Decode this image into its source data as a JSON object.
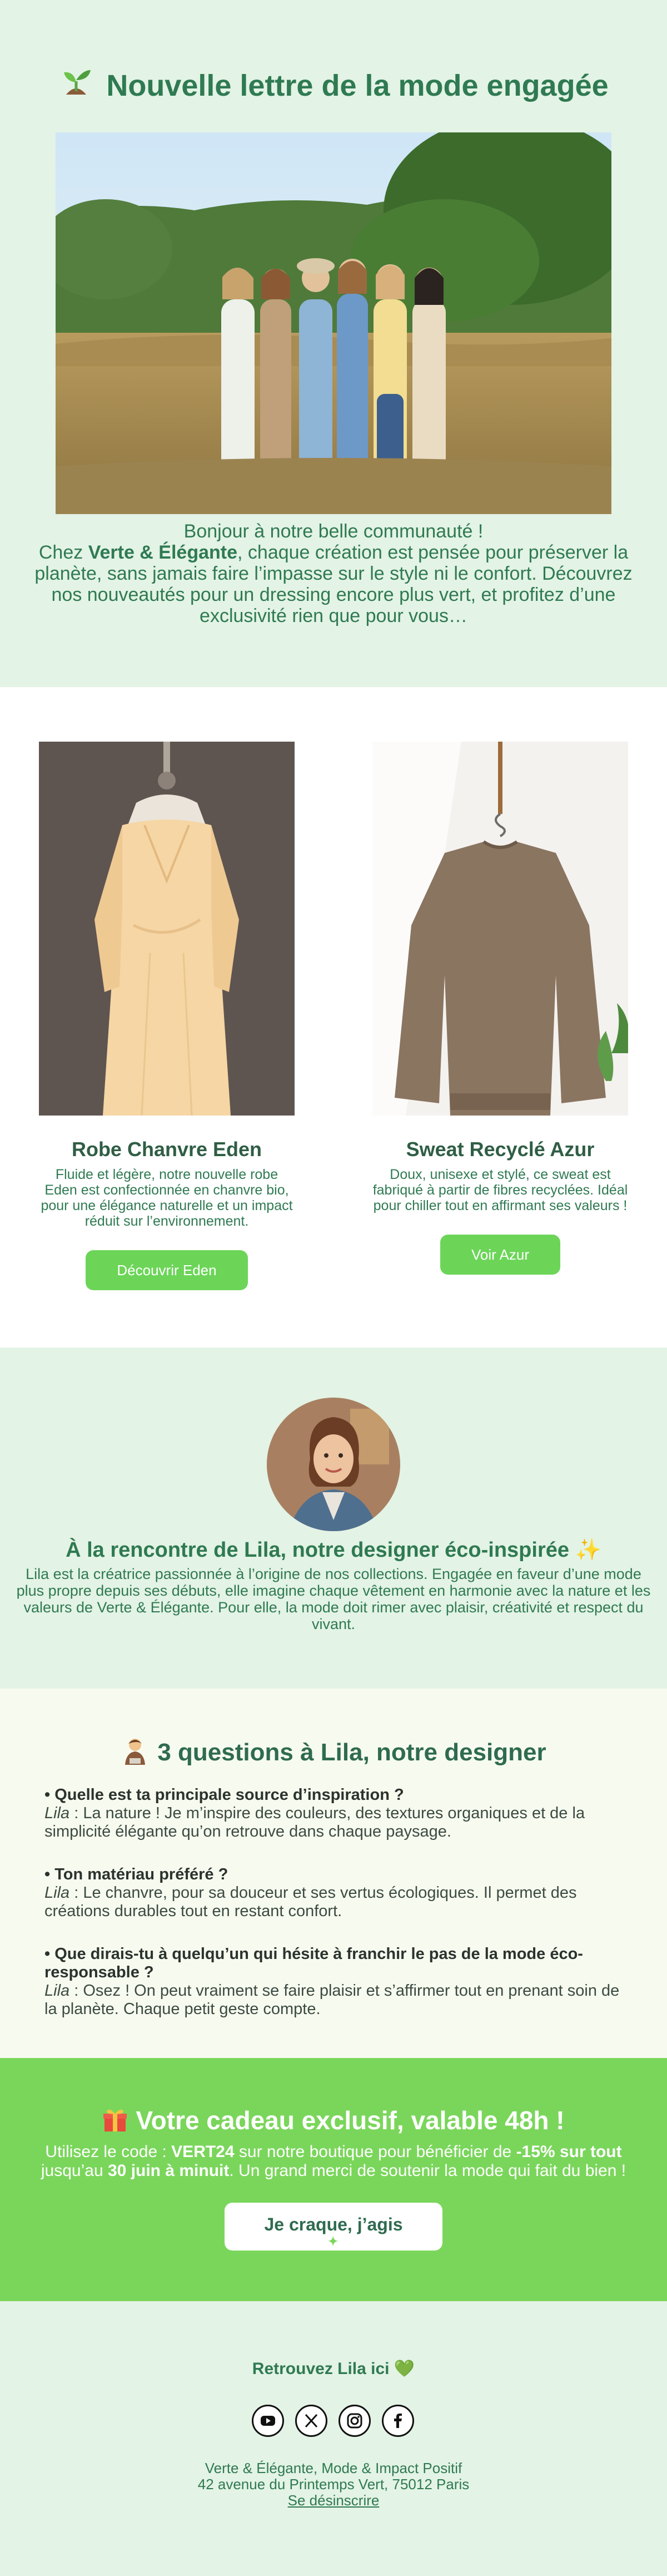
{
  "hero": {
    "title": "Nouvelle lettre de la mode engagée",
    "title_icon": "sprout-icon",
    "greeting": "Bonjour à notre belle communauté !",
    "intro_prefix": "Chez ",
    "brand": "Verte & Élégante",
    "intro_suffix": ", chaque création est pensée pour préserver la planète, sans jamais faire l’impasse sur le style ni le confort. Découvrez nos nouveautés pour un dressing encore plus vert, et profitez d’une exclusivité rien que pour vous…"
  },
  "products": [
    {
      "name": "Robe Chanvre Eden",
      "description": "Fluide et légère, notre nouvelle robe Eden est confectionnée en chanvre bio, pour une élégance naturelle et un impact réduit sur l’environnement.",
      "button": "Découvrir Eden"
    },
    {
      "name": "Sweat Recyclé Azur",
      "description": "Doux, unisexe et stylé, ce sweat est fabriqué à partir de fibres recyclées. Idéal pour chiller tout en affirmant ses valeurs !",
      "button": "Voir Azur"
    }
  ],
  "meet": {
    "title": "À la rencontre de Lila, notre designer éco-inspirée ✨",
    "text": "Lila est la créatrice passionnée à l’origine de nos collections. Engagée en faveur d’une mode plus propre depuis ses débuts, elle imagine chaque vêtement en harmonie avec la nature et les valeurs de Verte & Élégante. Pour elle, la mode doit rimer avec plaisir, créativité et respect du vivant."
  },
  "qa": {
    "title": "3 questions à Lila, notre designer",
    "title_icon": "designer-emoji-icon",
    "items": [
      {
        "question": "• Quelle est ta principale source d’inspiration ?",
        "speaker": "Lila",
        "answer": " : La nature ! Je m’inspire des couleurs, des textures organiques et de la simplicité élégante qu’on retrouve dans chaque paysage."
      },
      {
        "question": "• Ton matériau préféré ?",
        "speaker": "Lila",
        "answer": " : Le chanvre, pour sa douceur et ses vertus écologiques. Il permet des créations durables tout en restant confort."
      },
      {
        "question": "• Que dirais-tu à quelqu’un qui hésite à franchir le pas de la mode éco-responsable ?",
        "speaker": "Lila",
        "answer": " : Osez ! On peut vraiment se faire plaisir et s’affirmer tout en prenant soin de la planète. Chaque petit geste compte."
      }
    ]
  },
  "gift": {
    "title": "Votre cadeau exclusif, valable 48h !",
    "title_icon": "gift-icon",
    "text_1": "Utilisez le code : ",
    "code": "VERT24",
    "text_2": " sur notre boutique pour bénéficier de ",
    "discount": "-15% sur tout",
    "text_3": " jusqu’au ",
    "deadline": "30 juin à minuit",
    "text_4": ". Un grand merci de soutenir la mode qui fait du bien !",
    "button": "Je craque, j’agis"
  },
  "footer": {
    "follow": "Retrouvez Lila ici 💚",
    "socials": [
      "youtube-icon",
      "x-icon",
      "instagram-icon",
      "facebook-icon"
    ],
    "company": "Verte & Élégante, Mode & Impact Positif",
    "address": "42 avenue du Printemps Vert, 75012 Paris",
    "unsubscribe": "Se désinscrire"
  },
  "colors": {
    "mint_bg": "#e3f3e5",
    "brand_green": "#2f7a52",
    "button_green": "#6cd558",
    "gift_green": "#7ad65b",
    "qa_bg": "#f7fbef"
  }
}
